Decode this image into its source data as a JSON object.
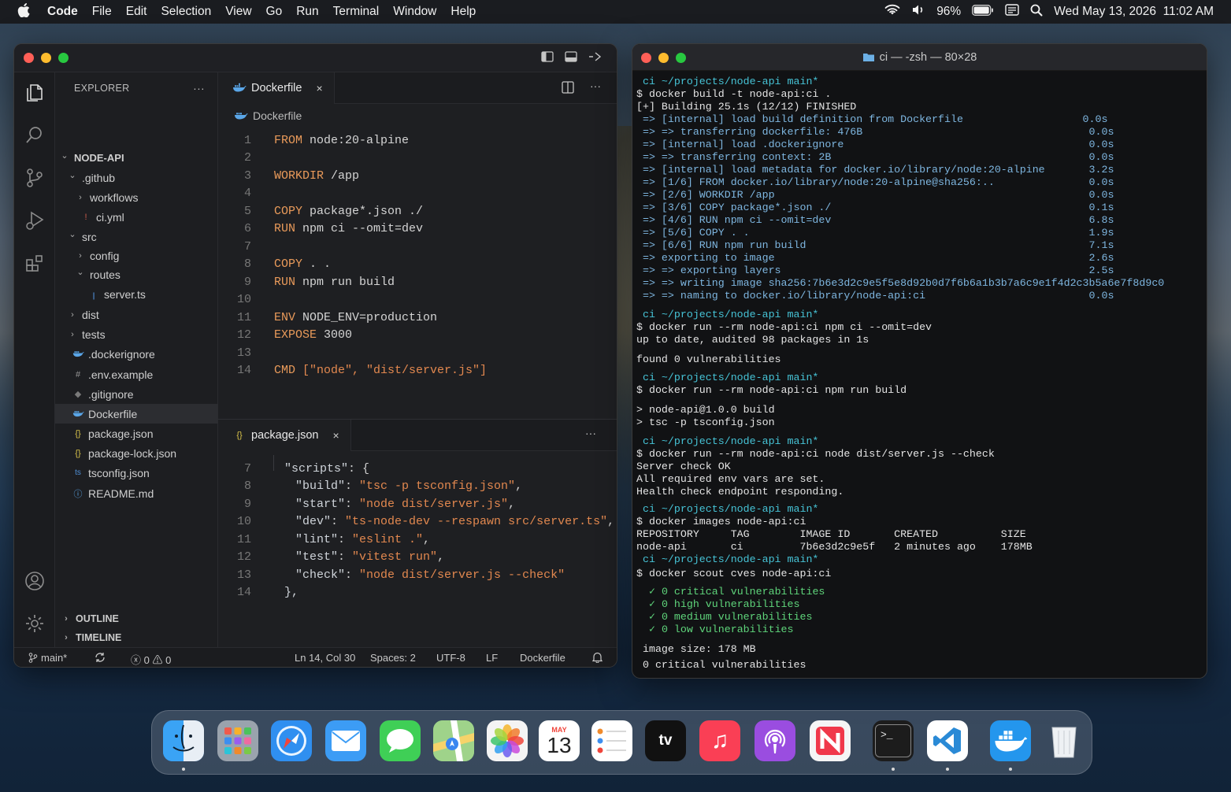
{
  "menubar": {
    "app": "Code",
    "items": [
      "File",
      "Edit",
      "Selection",
      "View",
      "Go",
      "Run",
      "Terminal",
      "Window",
      "Help"
    ],
    "battery": "96%",
    "datetime": "Wed May 13, 2026  11:02 AM"
  },
  "vscode": {
    "explorer": {
      "title": "EXPLORER",
      "more": "···",
      "project": "NODE-API",
      "tree": [
        {
          "label": "NODE-API",
          "chev": "⌄",
          "icon": "",
          "depth": 0,
          "bold": true
        },
        {
          "label": ".github",
          "chev": "⌄",
          "icon": "",
          "depth": 1
        },
        {
          "label": "workflows",
          "chev": "›",
          "icon": "",
          "depth": 2
        },
        {
          "label": "ci.yml",
          "chev": "",
          "icon": "!",
          "depth": 2
        },
        {
          "label": "src",
          "chev": "⌄",
          "icon": "",
          "depth": 1
        },
        {
          "label": "config",
          "chev": "›",
          "icon": "",
          "depth": 2
        },
        {
          "label": "routes",
          "chev": "⌄",
          "icon": "",
          "depth": 2
        },
        {
          "label": "server.ts",
          "chev": "",
          "icon": "TS",
          "depth": 3
        },
        {
          "label": "dist",
          "chev": "›",
          "icon": "",
          "depth": 1
        },
        {
          "label": "tests",
          "chev": "›",
          "icon": "",
          "depth": 1
        },
        {
          "label": ".dockerignore",
          "chev": "",
          "icon": "docker",
          "depth": 1
        },
        {
          "label": ".env.example",
          "chev": "",
          "icon": "#",
          "depth": 1
        },
        {
          "label": ".gitignore",
          "chev": "",
          "icon": "◆",
          "depth": 1
        },
        {
          "label": "Dockerfile",
          "chev": "",
          "icon": "docker",
          "depth": 1,
          "selected": true
        },
        {
          "label": "package.json",
          "chev": "",
          "icon": "{}",
          "depth": 1
        },
        {
          "label": "package-lock.json",
          "chev": "",
          "icon": "{}",
          "depth": 1
        },
        {
          "label": "tsconfig.json",
          "chev": "",
          "icon": "ts",
          "depth": 1
        },
        {
          "label": "README.md",
          "chev": "",
          "icon": "ⓘ",
          "depth": 1
        }
      ],
      "outline": "OUTLINE",
      "timeline": "TIMELINE"
    },
    "editor_top": {
      "tab": "Dockerfile",
      "close": "×",
      "breadcrumb": "Dockerfile",
      "lines": [
        {
          "n": "1",
          "kw": "FROM",
          "rest": " node:20-alpine"
        },
        {
          "n": "2",
          "kw": "",
          "rest": ""
        },
        {
          "n": "3",
          "kw": "WORKDIR",
          "rest": " /app"
        },
        {
          "n": "4",
          "kw": "",
          "rest": ""
        },
        {
          "n": "5",
          "kw": "COPY",
          "rest": " package*.json ./"
        },
        {
          "n": "6",
          "kw": "RUN",
          "rest": " npm ci --omit=dev"
        },
        {
          "n": "7",
          "kw": "",
          "rest": ""
        },
        {
          "n": "8",
          "kw": "COPY",
          "rest": " . ."
        },
        {
          "n": "9",
          "kw": "RUN",
          "rest": " npm run build"
        },
        {
          "n": "10",
          "kw": "",
          "rest": ""
        },
        {
          "n": "11",
          "kw": "ENV",
          "rest": " NODE_ENV=production"
        },
        {
          "n": "12",
          "kw": "EXPOSE",
          "rest": " 3000"
        },
        {
          "n": "13",
          "kw": "",
          "rest": ""
        },
        {
          "n": "14",
          "kw": "CMD",
          "rest": " [\"node\", \"dist/server.js\"]"
        }
      ]
    },
    "editor_bottom": {
      "tab": "package.json",
      "close": "×",
      "more": "···",
      "lines": [
        {
          "n": "7",
          "key": "\"scripts\"",
          "sep": ": {",
          "val": ""
        },
        {
          "n": "8",
          "key": "\"build\"",
          "sep": ": ",
          "val": "\"tsc -p tsconfig.json\"",
          "end": ","
        },
        {
          "n": "9",
          "key": "\"start\"",
          "sep": ": ",
          "val": "\"node dist/server.js\"",
          "end": ","
        },
        {
          "n": "10",
          "key": "\"dev\"",
          "sep": ": ",
          "val": "\"ts-node-dev --respawn src/server.ts\"",
          "end": ","
        },
        {
          "n": "11",
          "key": "\"lint\"",
          "sep": ": ",
          "val": "\"eslint .\"",
          "end": ","
        },
        {
          "n": "12",
          "key": "\"test\"",
          "sep": ": ",
          "val": "\"vitest run\"",
          "end": ","
        },
        {
          "n": "13",
          "key": "\"check\"",
          "sep": ": ",
          "val": "\"node dist/server.js --check\"",
          "end": ""
        },
        {
          "n": "14",
          "key": "},",
          "sep": "",
          "val": "",
          "end": ""
        }
      ]
    },
    "statusbar": {
      "branch": "main*",
      "errors": "0",
      "warnings": "0",
      "position": "Ln 14, Col 30",
      "spaces": "Spaces: 2",
      "encoding": "UTF-8",
      "eol": "LF",
      "language": "Dockerfile"
    }
  },
  "terminal": {
    "title": "ci — -zsh — 80×28",
    "lines": [
      {
        "t": "prompt",
        "text": " ci ~/projects/node-api main*"
      },
      {
        "t": "cmd",
        "text": "$ docker build -t node-api:ci ."
      },
      {
        "t": "out",
        "text": "[+] Building 25.1s (12/12) FINISHED"
      },
      {
        "t": "step",
        "text": " => [internal] load build definition from Dockerfile                   0.0s"
      },
      {
        "t": "step",
        "text": " => => transferring dockerfile: 476B                                    0.0s"
      },
      {
        "t": "step",
        "text": " => [internal] load .dockerignore                                       0.0s"
      },
      {
        "t": "step",
        "text": " => => transferring context: 2B                                         0.0s"
      },
      {
        "t": "step",
        "text": " => [internal] load metadata for docker.io/library/node:20-alpine       3.2s"
      },
      {
        "t": "step",
        "text": " => [1/6] FROM docker.io/library/node:20-alpine@sha256:..               0.0s"
      },
      {
        "t": "step",
        "text": " => [2/6] WORKDIR /app                                                  0.0s"
      },
      {
        "t": "step",
        "text": " => [3/6] COPY package*.json ./                                         0.1s"
      },
      {
        "t": "step",
        "text": " => [4/6] RUN npm ci --omit=dev                                         6.8s"
      },
      {
        "t": "step",
        "text": " => [5/6] COPY . .                                                      1.9s"
      },
      {
        "t": "step",
        "text": " => [6/6] RUN npm run build                                             7.1s"
      },
      {
        "t": "step",
        "text": " => exporting to image                                                  2.6s"
      },
      {
        "t": "step",
        "text": " => => exporting layers                                                 2.5s"
      },
      {
        "t": "step",
        "text": " => => writing image sha256:7b6e3d2c9e5f5e8d92b0d7f6b6a1b3b7a6c9e1f4d2c3b5a6e7f8d9c0"
      },
      {
        "t": "step",
        "text": " => => naming to docker.io/library/node-api:ci                          0.0s"
      },
      {
        "t": "prompt",
        "text": " ci ~/projects/node-api main*"
      },
      {
        "t": "cmd",
        "text": "$ docker run --rm node-api:ci npm ci --omit=dev"
      },
      {
        "t": "out",
        "text": "up to date, audited 98 packages in 1s"
      },
      {
        "t": "out",
        "text": "found 0 vulnerabilities"
      },
      {
        "t": "prompt",
        "text": " ci ~/projects/node-api main*"
      },
      {
        "t": "cmd",
        "text": "$ docker run --rm node-api:ci npm run build"
      },
      {
        "t": "out",
        "text": "> node-api@1.0.0 build"
      },
      {
        "t": "out",
        "text": "> tsc -p tsconfig.json"
      },
      {
        "t": "prompt",
        "text": " ci ~/projects/node-api main*"
      },
      {
        "t": "cmd",
        "text": "$ docker run --rm node-api:ci node dist/server.js --check"
      },
      {
        "t": "out",
        "text": "Server check OK"
      },
      {
        "t": "out",
        "text": "All required env vars are set."
      },
      {
        "t": "out",
        "text": "Health check endpoint responding."
      },
      {
        "t": "prompt",
        "text": " ci ~/projects/node-api main*"
      },
      {
        "t": "cmd",
        "text": "$ docker images node-api:ci"
      },
      {
        "t": "out",
        "text": "REPOSITORY     TAG        IMAGE ID       CREATED          SIZE"
      },
      {
        "t": "out",
        "text": "node-api       ci         7b6e3d2c9e5f   2 minutes ago    178MB"
      },
      {
        "t": "prompt",
        "text": " ci ~/projects/node-api main*"
      },
      {
        "t": "cmd",
        "text": "$ docker scout cves node-api:ci"
      },
      {
        "t": "ok",
        "text": "  ✓ 0 critical vulnerabilities"
      },
      {
        "t": "ok",
        "text": "  ✓ 0 high vulnerabilities"
      },
      {
        "t": "ok",
        "text": "  ✓ 0 medium vulnerabilities"
      },
      {
        "t": "ok",
        "text": "  ✓ 0 low vulnerabilities"
      },
      {
        "t": "out",
        "text": " image size: 178 MB"
      },
      {
        "t": "out",
        "text": " 0 critical vulnerabilities"
      }
    ]
  },
  "dock": {
    "apps": [
      {
        "name": "finder",
        "label": "",
        "color": "#2c8bf2"
      },
      {
        "name": "launchpad",
        "label": "",
        "color": "#9aa3ad"
      },
      {
        "name": "safari",
        "label": "",
        "color": "#2f8ff0"
      },
      {
        "name": "mail",
        "label": "",
        "color": "#3c9cf5"
      },
      {
        "name": "messages",
        "label": "",
        "color": "#3fcf56"
      },
      {
        "name": "maps",
        "label": "",
        "color": "#6fc27a"
      },
      {
        "name": "photos",
        "label": "",
        "color": "#f4f4f4"
      },
      {
        "name": "calendar",
        "label": "13",
        "month": "MAY",
        "color": "#ffffff"
      },
      {
        "name": "reminders",
        "label": "",
        "color": "#ffffff"
      },
      {
        "name": "apple-tv",
        "label": "tv",
        "color": "#111111"
      },
      {
        "name": "music",
        "label": "♫",
        "color": "#fa3f55"
      },
      {
        "name": "podcasts",
        "label": "",
        "color": "#9a4de0"
      },
      {
        "name": "news",
        "label": "",
        "color": "#f5f5f5"
      },
      {
        "name": "terminal",
        "label": ">_",
        "color": "#1c1c1c"
      },
      {
        "name": "vscode",
        "label": "",
        "color": "#ffffff"
      },
      {
        "name": "docker",
        "label": "",
        "color": "#2496ed"
      },
      {
        "name": "trash",
        "label": "",
        "color": "#d8dde2"
      }
    ]
  }
}
